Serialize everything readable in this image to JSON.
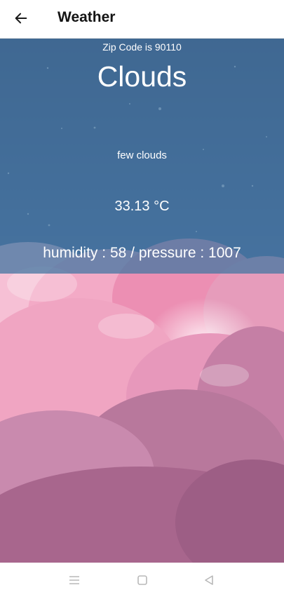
{
  "app_bar": {
    "title": "Weather",
    "back_icon": "arrow-left-icon"
  },
  "weather": {
    "zip_prefix": "Zip Code is",
    "zip_code": "90110",
    "main": "Clouds",
    "description": "few clouds",
    "temperature": "33.13",
    "temperature_unit": "°C",
    "humidity_label": "humidity :",
    "humidity": "58",
    "separator": "/",
    "pressure_label": "pressure :",
    "pressure": "1007"
  },
  "nav_bar": {
    "recents_icon": "menu-lines-icon",
    "home_icon": "square-home-icon",
    "back_icon": "triangle-back-icon"
  },
  "colors": {
    "panel_overlay": "#4979a3",
    "cloud_pink": "#f2a6c4",
    "cloud_mauve": "#b77497",
    "sky_blue": "#a8c9ef"
  }
}
